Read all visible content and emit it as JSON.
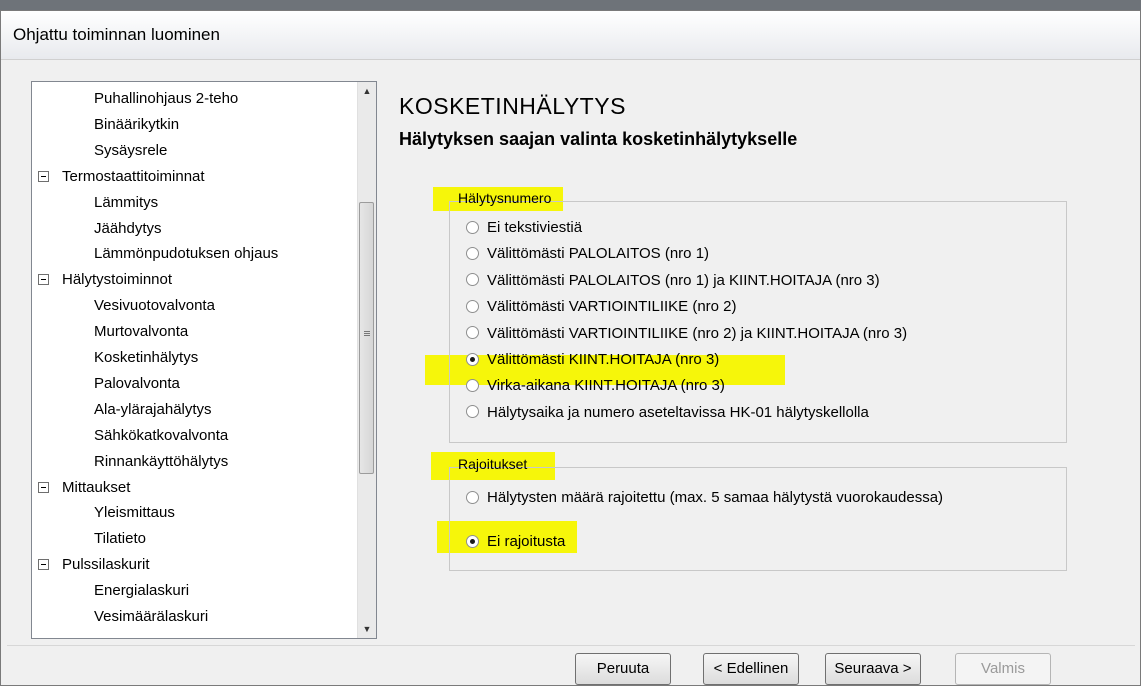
{
  "window": {
    "title": "Ohjattu toiminnan luominen"
  },
  "tree": {
    "items": [
      {
        "label": "Puhallinohjaus 2-teho",
        "level": 1
      },
      {
        "label": "Binäärikytkin",
        "level": 1
      },
      {
        "label": "Sysäysrele",
        "level": 1
      },
      {
        "label": "Termostaattitoiminnat",
        "level": 0,
        "expander": "collapse"
      },
      {
        "label": "Lämmitys",
        "level": 1
      },
      {
        "label": "Jäähdytys",
        "level": 1
      },
      {
        "label": "Lämmönpudotuksen ohjaus",
        "level": 1
      },
      {
        "label": "Hälytystoiminnot",
        "level": 0,
        "expander": "collapse"
      },
      {
        "label": "Vesivuotovalvonta",
        "level": 1
      },
      {
        "label": "Murtovalvonta",
        "level": 1
      },
      {
        "label": "Kosketinhälytys",
        "level": 1
      },
      {
        "label": "Palovalvonta",
        "level": 1
      },
      {
        "label": "Ala-ylärajahälytys",
        "level": 1
      },
      {
        "label": "Sähkökatkovalvonta",
        "level": 1
      },
      {
        "label": "Rinnankäyttöhälytys",
        "level": 1
      },
      {
        "label": "Mittaukset",
        "level": 0,
        "expander": "collapse"
      },
      {
        "label": "Yleismittaus",
        "level": 1
      },
      {
        "label": "Tilatieto",
        "level": 1
      },
      {
        "label": "Pulssilaskurit",
        "level": 0,
        "expander": "collapse"
      },
      {
        "label": "Energialaskuri",
        "level": 1
      },
      {
        "label": "Vesimäärälaskuri",
        "level": 1
      }
    ]
  },
  "page": {
    "heading": "KOSKETINHÄLYTYS",
    "subheading": "Hälytyksen saajan valinta kosketinhälytykselle"
  },
  "alarm_number": {
    "legend": "Hälytysnumero",
    "options": [
      "Ei tekstiviestiä",
      "Välittömästi PALOLAITOS (nro 1)",
      "Välittömästi PALOLAITOS (nro 1) ja KIINT.HOITAJA (nro 3)",
      "Välittömästi VARTIOINTILIIKE (nro 2)",
      "Välittömästi VARTIOINTILIIKE (nro 2) ja KIINT.HOITAJA (nro 3)",
      "Välittömästi KIINT.HOITAJA (nro 3)",
      "Virka-aikana KIINT.HOITAJA (nro 3)",
      "Hälytysaika ja numero aseteltavissa HK-01 hälytyskellolla"
    ],
    "selected_index": 5
  },
  "restrictions": {
    "legend": "Rajoitukset",
    "options": [
      "Hälytysten määrä rajoitettu (max. 5 samaa hälytystä vuorokaudessa)",
      "Ei rajoitusta"
    ],
    "selected_index": 1
  },
  "buttons": {
    "cancel": "Peruuta",
    "back": "< Edellinen",
    "next": "Seuraava >",
    "finish": "Valmis"
  },
  "colors": {
    "highlight": "#f6f60a",
    "window_bg": "#f0f0f0"
  }
}
